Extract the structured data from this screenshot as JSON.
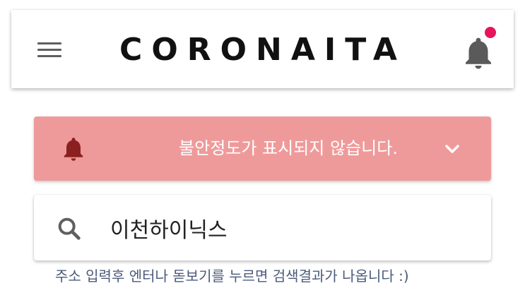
{
  "header": {
    "menu_icon": "hamburger-menu-icon",
    "logo_text": "CORONAITA",
    "notification_icon": "bell-icon",
    "notification_dot_color": "#e8155a"
  },
  "alert": {
    "icon": "bell-icon",
    "text": "불안정도가 표시되지 않습니다.",
    "toggle_icon": "chevron-down-icon",
    "background_color": "#ef9a9a"
  },
  "search": {
    "icon": "search-icon",
    "value": "이천하이닉스"
  },
  "hint": {
    "text": "주소 입력후 엔터나 돋보기를 누르면 검색결과가 나옵니다 :)"
  }
}
